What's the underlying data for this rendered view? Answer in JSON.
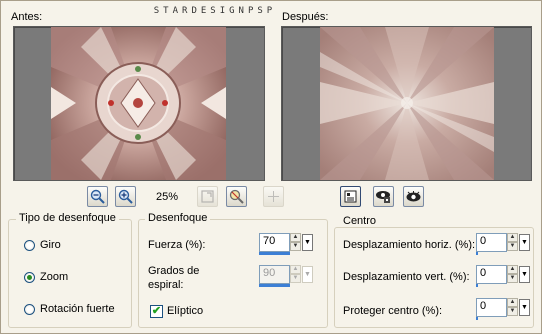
{
  "watermark": "STARDESIGNPSP",
  "preview": {
    "before_label": "Antes:",
    "after_label": "Después:"
  },
  "toolbar": {
    "zoom_level": "25%"
  },
  "blur_type": {
    "title": "Tipo de desenfoque",
    "options": [
      {
        "label": "Giro",
        "selected": false
      },
      {
        "label": "Zoom",
        "selected": true
      },
      {
        "label": "Rotación fuerte",
        "selected": false
      }
    ]
  },
  "blur": {
    "title": "Desenfoque",
    "strength_label": "Fuerza (%):",
    "strength_value": "70",
    "spiral_label_line1": "Grados de",
    "spiral_label_line2": "espiral:",
    "spiral_value": "90",
    "elliptic_label": "Elíptico",
    "elliptic_checked": true
  },
  "center": {
    "title": "Centro",
    "h_offset_label": "Desplazamiento horiz. (%):",
    "h_offset_value": "0",
    "v_offset_label": "Desplazamiento vert. (%):",
    "v_offset_value": "0",
    "protect_label": "Proteger centro (%):",
    "protect_value": "0"
  },
  "icons": [
    "zoom-out-icon",
    "zoom-in-icon",
    "fit-window-icon",
    "preview-zoom-icon",
    "move-icon",
    "proof-icon",
    "lock-preview-icon",
    "eye-icon"
  ],
  "colors": {
    "accent": "#3c7fd5",
    "preview_bg": "#7a7a7a",
    "dialog_bg": "#f6f3ea"
  }
}
